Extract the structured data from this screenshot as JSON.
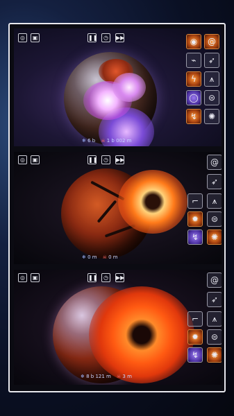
{
  "panels": [
    {
      "id": "panel-1",
      "stats": {
        "population": "6 b",
        "deaths": "1 b 002 m"
      },
      "left_controls": [
        "target-icon",
        "image-icon"
      ],
      "center_controls": [
        "pause-icon",
        "clock-icon",
        "fast-forward-icon"
      ],
      "tools": [
        "black-hole-icon",
        "spiral-galaxy-icon",
        "laser-icon",
        "missile-icon",
        "lightning-icon",
        "spikes-icon",
        "ring-icon",
        "ufo-icon",
        "electric-icon",
        "alien-icon"
      ]
    },
    {
      "id": "panel-2",
      "stats": {
        "population": "0 m",
        "deaths": "0 m"
      },
      "left_controls": [
        "target-icon",
        "image-icon"
      ],
      "center_controls": [
        "pause-icon",
        "clock-icon",
        "fast-forward-icon"
      ],
      "tools": [
        "spiral-galaxy-icon",
        "missile-icon",
        "hook-icon",
        "spikes-icon",
        "fireball-icon",
        "ufo-icon",
        "electric-icon",
        "alien-icon"
      ]
    },
    {
      "id": "panel-3",
      "stats": {
        "population": "8 b 121 m",
        "deaths": "3 m"
      },
      "left_controls": [
        "target-icon",
        "image-icon"
      ],
      "center_controls": [
        "pause-icon",
        "clock-icon",
        "fast-forward-icon"
      ],
      "tools": [
        "spiral-galaxy-icon",
        "missile-icon",
        "hook-icon",
        "spikes-icon",
        "fireball-icon",
        "ufo-icon",
        "electric-icon",
        "alien-icon"
      ]
    }
  ],
  "glyphs": {
    "target": "◎",
    "image": "▣",
    "pause": "❚❚",
    "clock": "◷",
    "ff": "▶▶",
    "black_hole": "◉",
    "spiral": "@",
    "laser": "⌁",
    "missile": "➶",
    "lightning": "ϟ",
    "spikes": "⩚",
    "ring": "◯",
    "ufo": "⊜",
    "electric": "↯",
    "alien": "✺",
    "hook": "⌐",
    "fireball": "✹",
    "pop": "❄",
    "dead": "☠"
  }
}
